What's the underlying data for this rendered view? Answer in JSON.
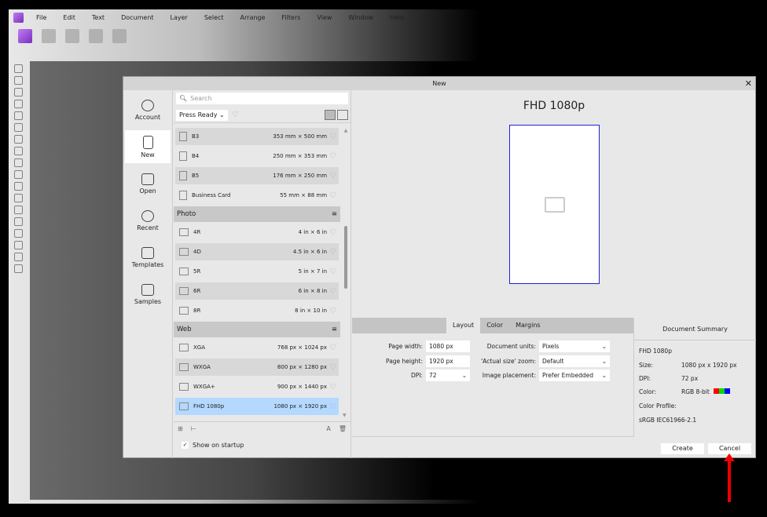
{
  "menu": [
    "File",
    "Edit",
    "Text",
    "Document",
    "Layer",
    "Select",
    "Arrange",
    "Filters",
    "View",
    "Window",
    "Help"
  ],
  "dialog": {
    "title": "New"
  },
  "sidebar": [
    {
      "label": "Account",
      "icon": "account-icon"
    },
    {
      "label": "New",
      "icon": "new-document-icon",
      "active": true
    },
    {
      "label": "Open",
      "icon": "folder-icon"
    },
    {
      "label": "Recent",
      "icon": "recent-icon"
    },
    {
      "label": "Templates",
      "icon": "templates-icon"
    },
    {
      "label": "Samples",
      "icon": "samples-icon"
    }
  ],
  "list": {
    "search_placeholder": "Search",
    "category": "Press Ready",
    "press_rows": [
      {
        "name": "B3",
        "size": "353 mm × 500 mm"
      },
      {
        "name": "B4",
        "size": "250 mm × 353 mm"
      },
      {
        "name": "B5",
        "size": "176 mm × 250 mm"
      },
      {
        "name": "Business Card",
        "size": "55 mm × 88 mm"
      }
    ],
    "photo_group": "Photo",
    "photo_rows": [
      {
        "name": "4R",
        "size": "4 in × 6 in"
      },
      {
        "name": "4D",
        "size": "4.5 in × 6 in"
      },
      {
        "name": "5R",
        "size": "5 in × 7 in"
      },
      {
        "name": "6R",
        "size": "6 in × 8 in"
      },
      {
        "name": "8R",
        "size": "8 in × 10 in"
      }
    ],
    "web_group": "Web",
    "web_rows": [
      {
        "name": "XGA",
        "size": "768 px × 1024 px"
      },
      {
        "name": "WXGA",
        "size": "800 px × 1280 px"
      },
      {
        "name": "WXGA+",
        "size": "900 px × 1440 px"
      },
      {
        "name": "FHD 1080p",
        "size": "1080 px × 1920 px",
        "selected": true
      }
    ],
    "show_on_startup": "Show on startup",
    "show_on_startup_checked": true
  },
  "preview": {
    "title": "FHD 1080p"
  },
  "tabs": [
    {
      "label": "Layout",
      "active": true
    },
    {
      "label": "Color"
    },
    {
      "label": "Margins"
    }
  ],
  "layout": {
    "page_width_label": "Page width:",
    "page_width": "1080 px",
    "page_height_label": "Page height:",
    "page_height": "1920 px",
    "dpi_label": "DPI:",
    "dpi": "72",
    "units_label": "Document units:",
    "units": "Pixels",
    "zoom_label": "'Actual size' zoom:",
    "zoom": "Default",
    "placement_label": "Image placement:",
    "placement": "Prefer Embedded"
  },
  "summary": {
    "title": "Document Summary",
    "name": "FHD 1080p",
    "size_label": "Size:",
    "size": "1080 px  x  1920 px",
    "dpi_label": "DPI:",
    "dpi": "72 px",
    "color_label": "Color:",
    "color": "RGB 8-bit",
    "profile_label": "Color Profile:",
    "profile": "sRGB IEC61966-2.1",
    "rgb_colors": [
      "#ff0000",
      "#00dd00",
      "#0000ff"
    ]
  },
  "buttons": {
    "create": "Create",
    "cancel": "Cancel"
  },
  "annotation_color": "#ee0000"
}
